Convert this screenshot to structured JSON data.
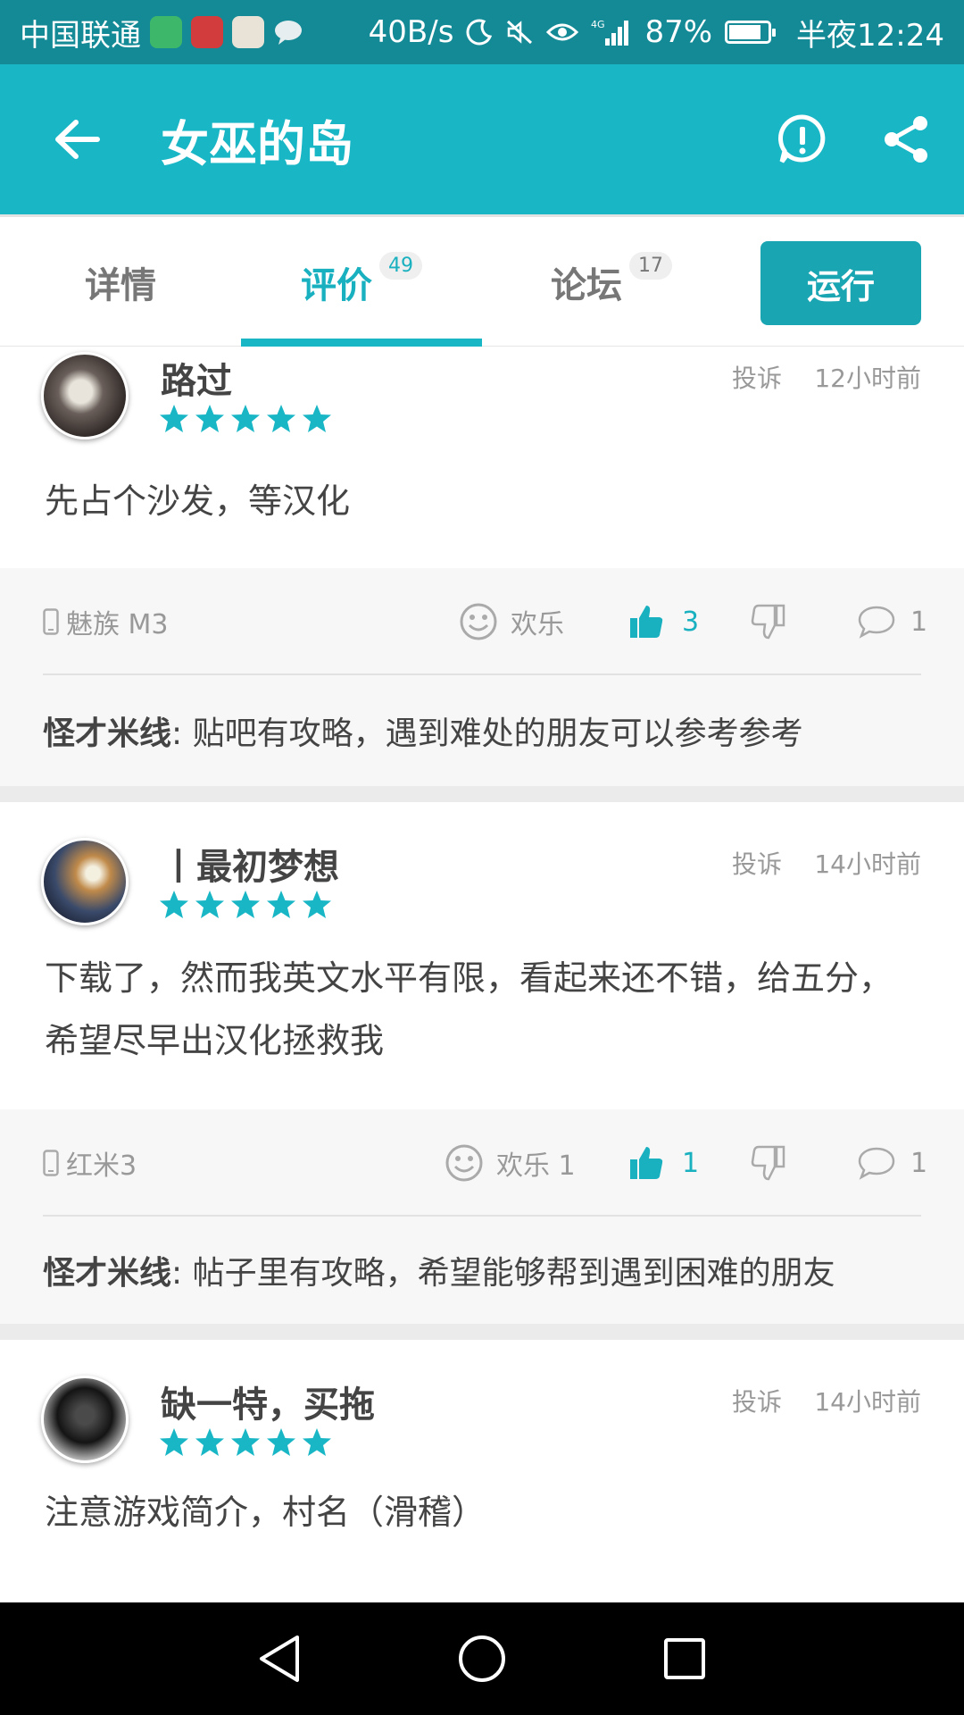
{
  "status_bar": {
    "carrier": "中国联通",
    "speed": "40B/s",
    "network": "4G",
    "battery": "87%",
    "battery_level": 0.87,
    "time": "半夜12:24"
  },
  "app_bar": {
    "title": "女巫的岛"
  },
  "tabs": [
    {
      "label": "详情",
      "badge": ""
    },
    {
      "label": "评价",
      "badge": "49"
    },
    {
      "label": "论坛",
      "badge": "17"
    }
  ],
  "active_tab": "评价",
  "run_label": "运行",
  "accent_color": "#19b6c6",
  "reviews": [
    {
      "user": "路过",
      "rating": 5,
      "report": "投诉",
      "time": "12小时前",
      "text": "先占个沙发，等汉化",
      "device": "魅族 M3",
      "mood": "欢乐",
      "likes": "3",
      "comments": "1",
      "reply_name": "怪才米线",
      "reply_text": " : 贴吧有攻略，遇到难处的朋友可以参考参考"
    },
    {
      "user": "丨最初梦想",
      "rating": 5,
      "report": "投诉",
      "time": "14小时前",
      "text": "下载了，然而我英文水平有限，看起来还不错，给五分，希望尽早出汉化拯救我",
      "device": "红米3",
      "mood": "欢乐 1",
      "likes": "1",
      "comments": "1",
      "reply_name": "怪才米线",
      "reply_text": " : 帖子里有攻略，希望能够帮到遇到困难的朋友"
    },
    {
      "user": "缺一特，买拖",
      "rating": 5,
      "report": "投诉",
      "time": "14小时前",
      "text": "注意游戏简介，村名（滑稽）"
    }
  ]
}
